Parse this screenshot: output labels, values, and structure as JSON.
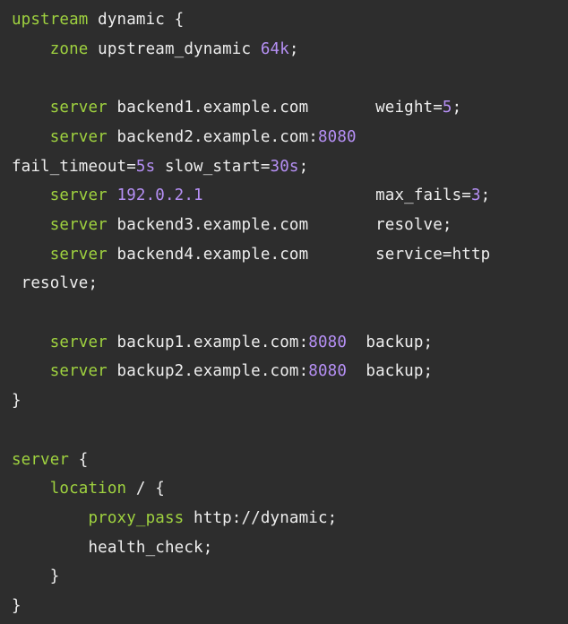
{
  "colors": {
    "background": "#2d2d2d",
    "plain_text": "#eeeeee",
    "keyword": "#9fd23f",
    "number": "#b690f5"
  },
  "code_lines": [
    [
      {
        "t": "kw",
        "s": "upstream"
      },
      {
        "t": "plain",
        "s": " dynamic {"
      }
    ],
    [
      {
        "t": "plain",
        "s": "    "
      },
      {
        "t": "kw",
        "s": "zone"
      },
      {
        "t": "plain",
        "s": " upstream_dynamic "
      },
      {
        "t": "num",
        "s": "64k"
      },
      {
        "t": "plain",
        "s": ";"
      }
    ],
    [],
    [
      {
        "t": "plain",
        "s": "    "
      },
      {
        "t": "kw",
        "s": "server"
      },
      {
        "t": "plain",
        "s": " backend1.example.com       weight="
      },
      {
        "t": "num",
        "s": "5"
      },
      {
        "t": "plain",
        "s": ";"
      }
    ],
    [
      {
        "t": "plain",
        "s": "    "
      },
      {
        "t": "kw",
        "s": "server"
      },
      {
        "t": "plain",
        "s": " backend2.example.com:"
      },
      {
        "t": "num",
        "s": "8080"
      }
    ],
    [
      {
        "t": "plain",
        "s": "fail_timeout="
      },
      {
        "t": "num",
        "s": "5s"
      },
      {
        "t": "plain",
        "s": " slow_start="
      },
      {
        "t": "num",
        "s": "30s"
      },
      {
        "t": "plain",
        "s": ";"
      }
    ],
    [
      {
        "t": "plain",
        "s": "    "
      },
      {
        "t": "kw",
        "s": "server"
      },
      {
        "t": "plain",
        "s": " "
      },
      {
        "t": "num",
        "s": "192.0.2.1"
      },
      {
        "t": "plain",
        "s": "                  max_fails="
      },
      {
        "t": "num",
        "s": "3"
      },
      {
        "t": "plain",
        "s": ";"
      }
    ],
    [
      {
        "t": "plain",
        "s": "    "
      },
      {
        "t": "kw",
        "s": "server"
      },
      {
        "t": "plain",
        "s": " backend3.example.com       resolve;"
      }
    ],
    [
      {
        "t": "plain",
        "s": "    "
      },
      {
        "t": "kw",
        "s": "server"
      },
      {
        "t": "plain",
        "s": " backend4.example.com       service=http"
      }
    ],
    [
      {
        "t": "plain",
        "s": " resolve;"
      }
    ],
    [],
    [
      {
        "t": "plain",
        "s": "    "
      },
      {
        "t": "kw",
        "s": "server"
      },
      {
        "t": "plain",
        "s": " backup1.example.com:"
      },
      {
        "t": "num",
        "s": "8080"
      },
      {
        "t": "plain",
        "s": "  backup;"
      }
    ],
    [
      {
        "t": "plain",
        "s": "    "
      },
      {
        "t": "kw",
        "s": "server"
      },
      {
        "t": "plain",
        "s": " backup2.example.com:"
      },
      {
        "t": "num",
        "s": "8080"
      },
      {
        "t": "plain",
        "s": "  backup;"
      }
    ],
    [
      {
        "t": "plain",
        "s": "}"
      }
    ],
    [],
    [
      {
        "t": "kw",
        "s": "server"
      },
      {
        "t": "plain",
        "s": " {"
      }
    ],
    [
      {
        "t": "plain",
        "s": "    "
      },
      {
        "t": "kw",
        "s": "location"
      },
      {
        "t": "plain",
        "s": " / {"
      }
    ],
    [
      {
        "t": "plain",
        "s": "        "
      },
      {
        "t": "kw",
        "s": "proxy_pass"
      },
      {
        "t": "plain",
        "s": " http://dynamic;"
      }
    ],
    [
      {
        "t": "plain",
        "s": "        health_check;"
      }
    ],
    [
      {
        "t": "plain",
        "s": "    }"
      }
    ],
    [
      {
        "t": "plain",
        "s": "}"
      }
    ]
  ]
}
